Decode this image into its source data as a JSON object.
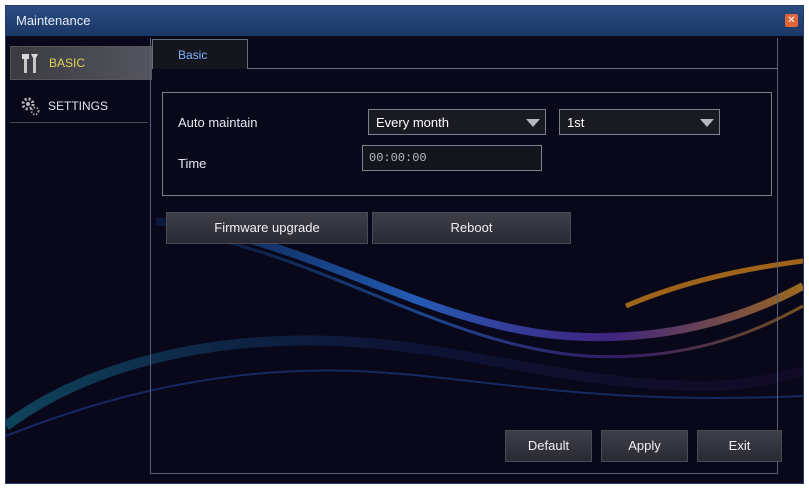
{
  "window": {
    "title": "Maintenance",
    "close_icon": "close-icon"
  },
  "sidebar": {
    "items": [
      {
        "label": "BASIC",
        "icon": "tools-icon",
        "selected": true
      },
      {
        "label": "SETTINGS",
        "icon": "gear-icon",
        "selected": false
      }
    ]
  },
  "tabs": [
    {
      "label": "Basic",
      "active": true
    }
  ],
  "form": {
    "auto_maintain_label": "Auto maintain",
    "auto_maintain_value": "Every month",
    "day_value": "1st",
    "time_label": "Time",
    "time_value": "00:00:00"
  },
  "buttons": {
    "firmware_upgrade": "Firmware upgrade",
    "reboot": "Reboot",
    "default": "Default",
    "apply": "Apply",
    "exit": "Exit"
  },
  "colors": {
    "titlebar": "#1f3f74",
    "selected_item_text": "#e2d35a",
    "tab_text": "#7fb2ff",
    "close_button": "#e0653a"
  }
}
